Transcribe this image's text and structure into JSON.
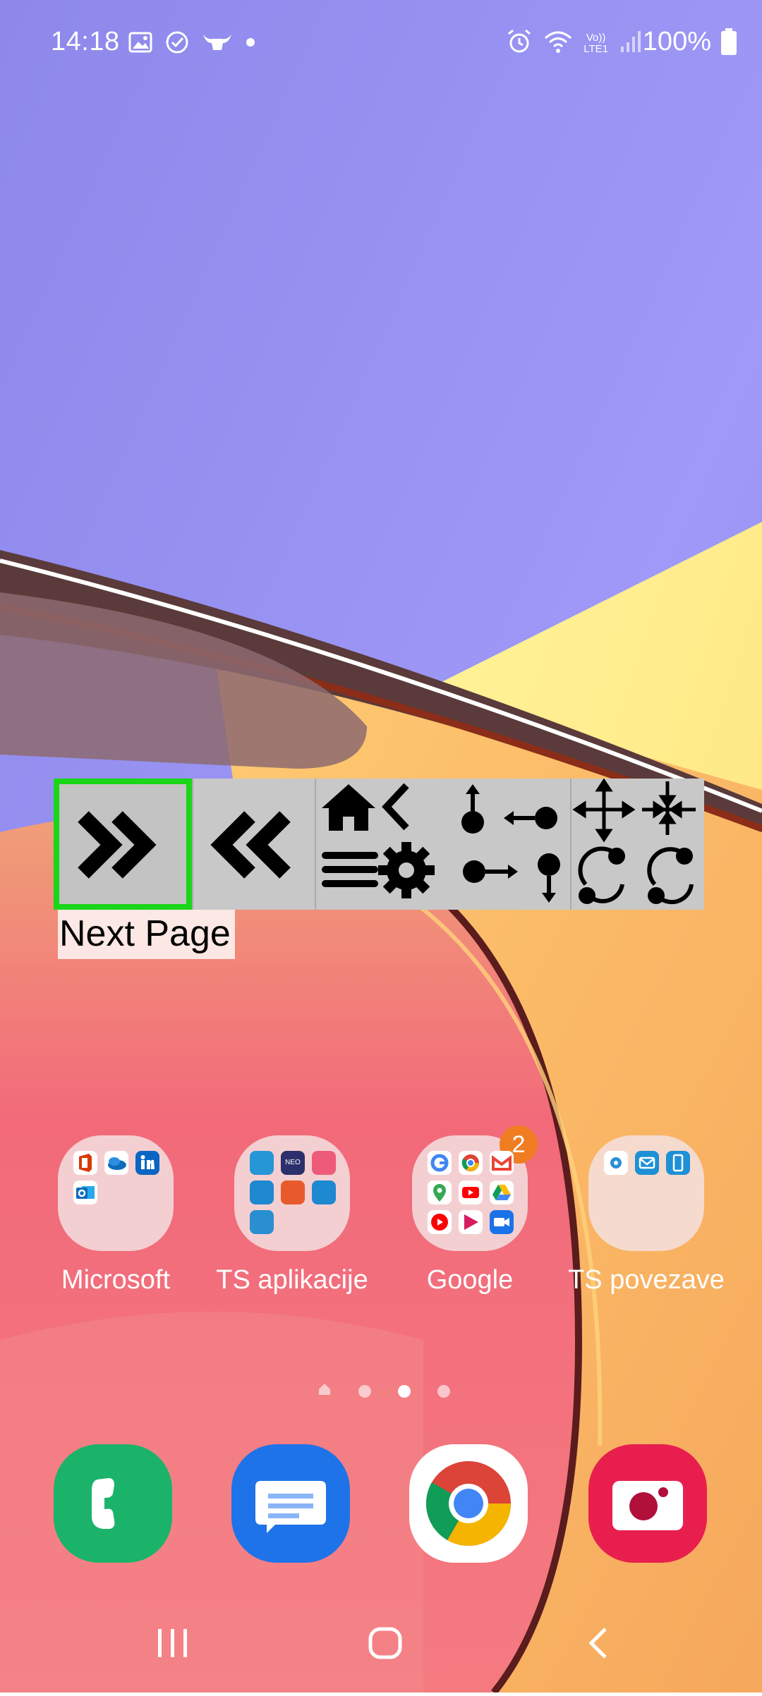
{
  "status_bar": {
    "time": "14:18",
    "left_icons": [
      "gallery-icon",
      "check-circle-icon",
      "bull-icon",
      "dot-icon"
    ],
    "right_icons": [
      "alarm-icon",
      "wifi-icon",
      "volte-icon",
      "signal-icon"
    ],
    "volte_text": "Vo))",
    "lte_text": "LTE1",
    "battery": "100%"
  },
  "overlay_toolbar": {
    "buttons": [
      {
        "name": "next-page",
        "icon": "double-chevron-right-icon",
        "selected": true
      },
      {
        "name": "previous-page",
        "icon": "double-chevron-left-icon",
        "selected": false
      },
      {
        "name": "navigation",
        "icons": [
          "home-icon",
          "back-icon",
          "menu-icon",
          "settings-icon"
        ]
      },
      {
        "name": "gestures",
        "icons": [
          "swipe-up-icon",
          "swipe-left-icon",
          "swipe-right-icon",
          "swipe-down-icon"
        ]
      },
      {
        "name": "zoom-rotate",
        "icons": [
          "expand-icon",
          "collapse-icon",
          "rotate-left-icon",
          "rotate-right-icon"
        ]
      }
    ],
    "selected_label": "Next Page",
    "highlight_color": "#19d619"
  },
  "folders": [
    {
      "label": "Microsoft",
      "badge": null
    },
    {
      "label": "TS aplikacije",
      "badge": null,
      "inner_text": "NEO"
    },
    {
      "label": "Google",
      "badge": "2"
    },
    {
      "label": "TS povezave",
      "badge": null
    }
  ],
  "page_indicator": {
    "count": 4,
    "active_index": 2
  },
  "dock": [
    {
      "name": "phone",
      "color": "#1bb36a"
    },
    {
      "name": "messages",
      "color": "#1f73e8"
    },
    {
      "name": "chrome",
      "color": "#ffffff"
    },
    {
      "name": "camera",
      "color": "#e81f4e"
    }
  ],
  "navbar": [
    "recents-button",
    "home-button",
    "back-button"
  ]
}
